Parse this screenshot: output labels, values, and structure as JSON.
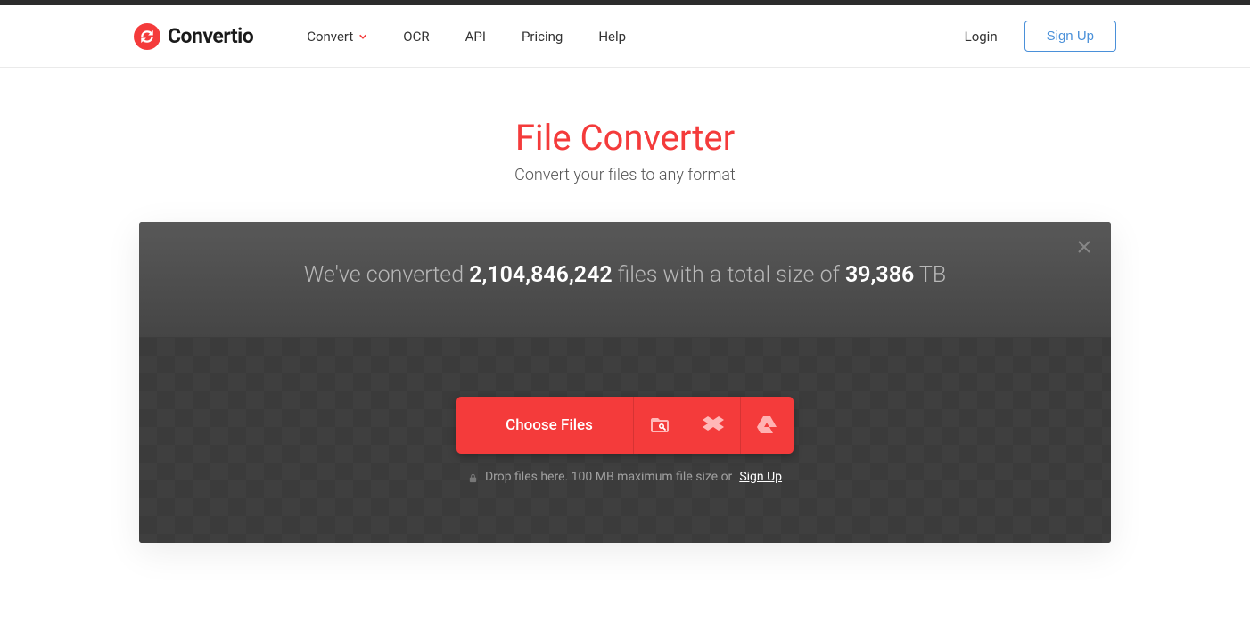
{
  "logo": {
    "text": "Convertio"
  },
  "nav": {
    "convert": "Convert",
    "ocr": "OCR",
    "api": "API",
    "pricing": "Pricing",
    "help": "Help"
  },
  "auth": {
    "login": "Login",
    "signup": "Sign Up"
  },
  "hero": {
    "title": "File Converter",
    "subtitle": "Convert your files to any format"
  },
  "stats": {
    "prefix": "We've converted ",
    "files_count": "2,104,846,242",
    "middle": " files with a total size of ",
    "size": "39,386",
    "unit": " TB"
  },
  "uploader": {
    "choose_label": "Choose Files",
    "hint_prefix": "Drop files here. 100 MB maximum file size or ",
    "hint_signup": "Sign Up"
  }
}
